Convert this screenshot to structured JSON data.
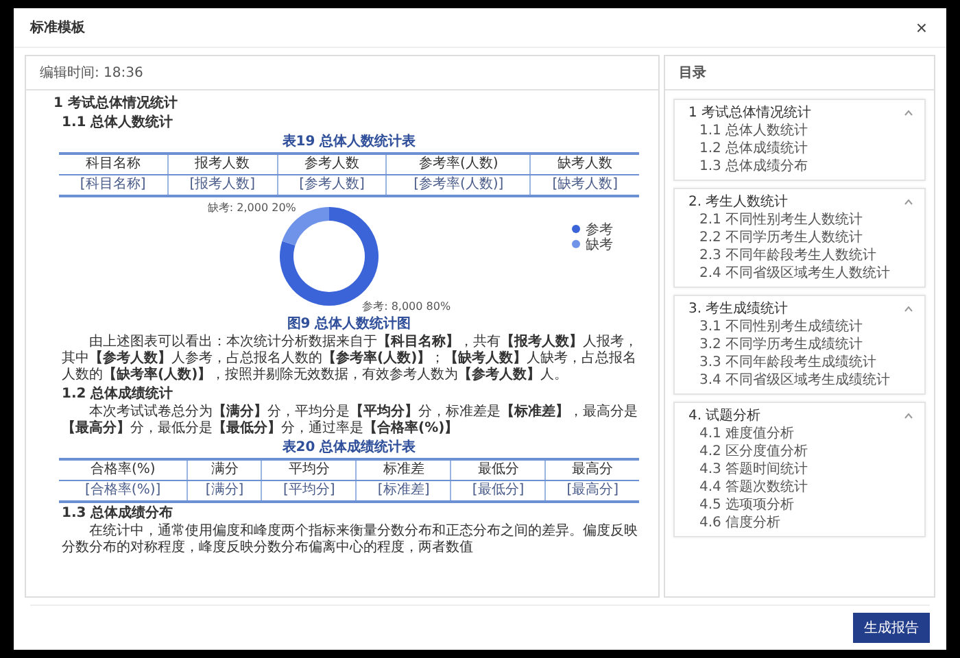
{
  "dialog": {
    "title": "标准模板",
    "close": "×"
  },
  "report": {
    "edit_time": "编辑时间: 18:36",
    "blocks": [
      {
        "kind": "h1",
        "text": "1 考试总体情况统计"
      },
      {
        "kind": "h2",
        "text": "1.1 总体人数统计"
      },
      {
        "kind": "caption",
        "text": "表19 总体人数统计表"
      },
      {
        "kind": "table",
        "columns": [
          "科目名称",
          "报考人数",
          "参考人数",
          "参考率(人数)",
          "缺考人数"
        ],
        "rows": [
          [
            "[科目名称]",
            "[报考人数]",
            "[参考人数]",
            "[参考率(人数)]",
            "[缺考人数]"
          ]
        ]
      },
      {
        "kind": "chart",
        "chart_data": {
          "type": "donut",
          "categories": [
            "参考",
            "缺考"
          ],
          "values": [
            8000,
            2000
          ],
          "colors": [
            "#3a64d8",
            "#6f93e8"
          ],
          "value_labels": [
            "参考: 8,000 80%",
            "缺考: 2,000 20%"
          ],
          "legend": "right"
        }
      },
      {
        "kind": "caption",
        "text": "图9 总体人数统计图"
      },
      {
        "kind": "para",
        "text": "由上述图表可以看出：本次统计分析数据来自于**【科目名称】**，共有**【报考人数】**人报考，其中**【参考人数】**人参考，占总报名人数的**【参考率(人数)】**；**【缺考人数】**人缺考，占总报名人数的**【缺考率(人数)】**，按照并剔除无效数据，有效参考人数为**【参考人数】**人。"
      },
      {
        "kind": "h2",
        "text": "1.2 总体成绩统计"
      },
      {
        "kind": "para",
        "text": "本次考试试卷总分为**【满分】**分，平均分是**【平均分】**分，标准差是**【标准差】**，最高分是**【最高分】**分，最低分是**【最低分】**分，通过率是**【合格率(%)】**"
      },
      {
        "kind": "caption",
        "text": "表20 总体成绩统计表"
      },
      {
        "kind": "table",
        "columns": [
          "合格率(%)",
          "满分",
          "平均分",
          "标准差",
          "最低分",
          "最高分"
        ],
        "rows": [
          [
            "[合格率(%)]",
            "[满分]",
            "[平均分]",
            "[标准差]",
            "[最低分]",
            "[最高分]"
          ]
        ]
      },
      {
        "kind": "h2",
        "text": "1.3 总体成绩分布"
      },
      {
        "kind": "para",
        "text": "在统计中，通常使用偏度和峰度两个指标来衡量分数分布和正态分布之间的差异。偏度反映分数分布的对称程度，峰度反映分数分布偏离中心的程度，两者数值"
      }
    ]
  },
  "toc": {
    "title": "目录",
    "groups": [
      {
        "title": "1 考试总体情况统计",
        "expanded": true,
        "items": [
          "1.1 总体人数统计",
          "1.2 总体成绩统计",
          "1.3 总体成绩分布"
        ]
      },
      {
        "title": "2. 考生人数统计",
        "expanded": true,
        "items": [
          "2.1 不同性别考生人数统计",
          "2.2 不同学历考生人数统计",
          "2.3 不同年龄段考生人数统计",
          "2.4 不同省级区域考生人数统计"
        ]
      },
      {
        "title": "3. 考生成绩统计",
        "expanded": true,
        "items": [
          "3.1 不同性别考生成绩统计",
          "3.2 不同学历考生成绩统计",
          "3.3 不同年龄段考生成绩统计",
          "3.4 不同省级区域考生成绩统计"
        ]
      },
      {
        "title": "4. 试题分析",
        "expanded": true,
        "items": [
          "4.1 难度值分析",
          "4.2 区分度值分析",
          "4.3 答题时间统计",
          "4.4 答题次数统计",
          "4.5 选项项分析",
          "4.6 信度分析"
        ]
      }
    ]
  },
  "footer": {
    "button": "生成报告"
  }
}
